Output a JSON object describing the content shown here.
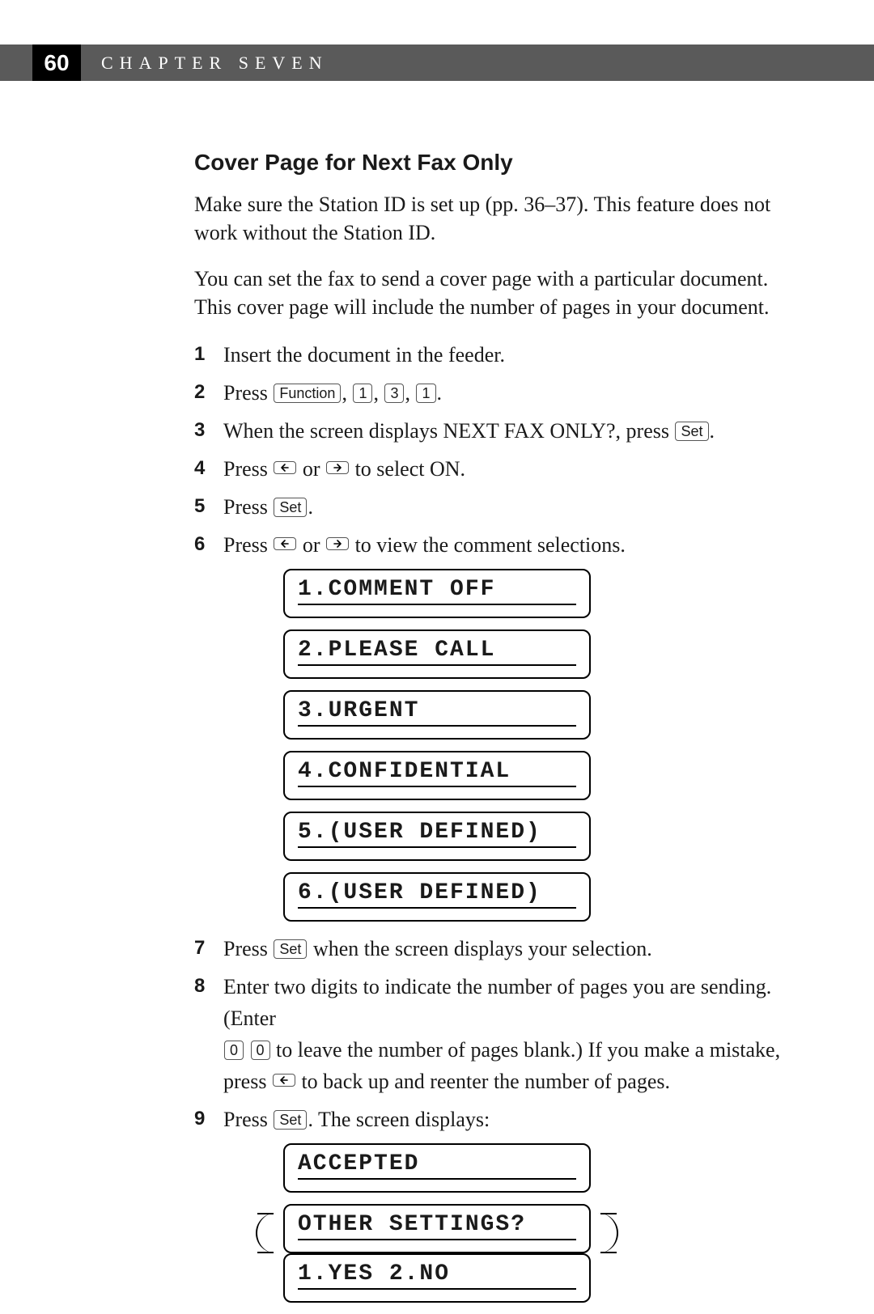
{
  "header": {
    "page_number": "60",
    "chapter_label": "CHAPTER SEVEN"
  },
  "section": {
    "title": "Cover Page for Next Fax Only",
    "intro1": "Make sure the Station ID is set up (pp. 36–37). This feature does not work without the Station ID.",
    "intro2": "You can set the fax to send a cover page with a particular document. This cover page will include the number of pages in your document."
  },
  "keys": {
    "function": "Function",
    "one": "1",
    "three": "3",
    "set": "Set",
    "zero": "0"
  },
  "steps": {
    "s1": {
      "num": "1",
      "text": "Insert the document in the feeder."
    },
    "s2": {
      "num": "2",
      "pre": "Press ",
      "seq_sep": ", ",
      "post": "."
    },
    "s3": {
      "num": "3",
      "pre": "When the screen displays NEXT FAX ONLY?, press ",
      "post": "."
    },
    "s4": {
      "num": "4",
      "pre": "Press ",
      "mid": " or ",
      "post": " to select ON."
    },
    "s5": {
      "num": "5",
      "pre": "Press ",
      "post": "."
    },
    "s6": {
      "num": "6",
      "pre": "Press ",
      "mid": " or ",
      "post": " to view the comment selections."
    },
    "s7": {
      "num": "7",
      "pre": "Press ",
      "post": " when the screen displays your selection."
    },
    "s8": {
      "num": "8",
      "line1": "Enter two digits to indicate the number of pages you are sending. (Enter",
      "line2a": " to leave the number of pages blank.) If you make a mistake, press ",
      "line2b": " to back up and reenter the number of pages."
    },
    "s9": {
      "num": "9",
      "pre": "Press ",
      "post": ". The screen displays:"
    }
  },
  "lcd_options": [
    "1.COMMENT OFF",
    "2.PLEASE CALL",
    "3.URGENT",
    "4.CONFIDENTIAL",
    "5.(USER DEFINED)",
    "6.(USER DEFINED)"
  ],
  "lcd_final": [
    "ACCEPTED",
    "OTHER SETTINGS?",
    "1.YES 2.NO"
  ]
}
